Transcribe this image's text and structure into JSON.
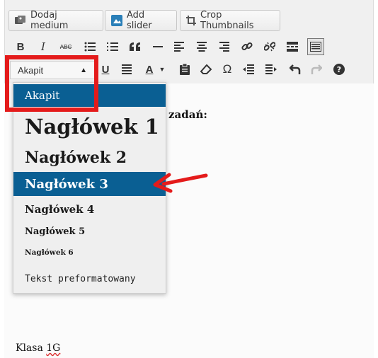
{
  "media_buttons": {
    "add_media": "Dodaj medium",
    "add_slider": "Add slider",
    "crop_thumbnails": "Crop Thumbnails"
  },
  "toolbar": {
    "bold": "B",
    "italic": "I",
    "strikethrough": "ABC",
    "quote": "66",
    "format_select": "Akapit",
    "underline": "U",
    "text_color": "A",
    "special_char": "Ω"
  },
  "format_dropdown": {
    "items": [
      {
        "label": "Akapit",
        "selected": true
      },
      {
        "label": "Nagłówek 1",
        "selected": false
      },
      {
        "label": "Nagłówek 2",
        "selected": false
      },
      {
        "label": "Nagłówek 3",
        "selected": true
      },
      {
        "label": "Nagłówek 4",
        "selected": false
      },
      {
        "label": "Nagłówek 5",
        "selected": false
      },
      {
        "label": "Nagłówek 6",
        "selected": false
      },
      {
        "label": "Tekst preformatowany",
        "selected": false
      }
    ]
  },
  "content": {
    "partial_heading": "zadań:",
    "footer_text_prefix": "Klasa ",
    "footer_text_flagged": "1G"
  },
  "colors": {
    "accent_blue": "#0a5f93",
    "callout_red": "#e41b1b"
  }
}
